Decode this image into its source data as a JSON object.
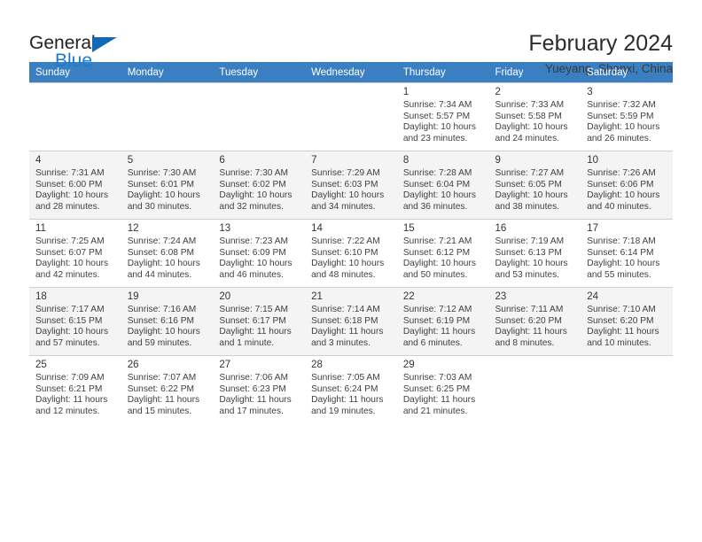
{
  "logo": {
    "word_top": "General",
    "word_bottom": "Blue",
    "accent_color": "#1268b3",
    "blue_text_color": "#1a7bd4"
  },
  "header": {
    "title": "February 2024",
    "subtitle": "Yueyang, Shanxi, China",
    "header_bg": "#3a7fc1"
  },
  "weekdays": [
    "Sunday",
    "Monday",
    "Tuesday",
    "Wednesday",
    "Thursday",
    "Friday",
    "Saturday"
  ],
  "weeks": [
    [
      {
        "day": "",
        "info": ""
      },
      {
        "day": "",
        "info": ""
      },
      {
        "day": "",
        "info": ""
      },
      {
        "day": "",
        "info": ""
      },
      {
        "day": "1",
        "info": "Sunrise: 7:34 AM\nSunset: 5:57 PM\nDaylight: 10 hours\nand 23 minutes."
      },
      {
        "day": "2",
        "info": "Sunrise: 7:33 AM\nSunset: 5:58 PM\nDaylight: 10 hours\nand 24 minutes."
      },
      {
        "day": "3",
        "info": "Sunrise: 7:32 AM\nSunset: 5:59 PM\nDaylight: 10 hours\nand 26 minutes."
      }
    ],
    [
      {
        "day": "4",
        "info": "Sunrise: 7:31 AM\nSunset: 6:00 PM\nDaylight: 10 hours\nand 28 minutes."
      },
      {
        "day": "5",
        "info": "Sunrise: 7:30 AM\nSunset: 6:01 PM\nDaylight: 10 hours\nand 30 minutes."
      },
      {
        "day": "6",
        "info": "Sunrise: 7:30 AM\nSunset: 6:02 PM\nDaylight: 10 hours\nand 32 minutes."
      },
      {
        "day": "7",
        "info": "Sunrise: 7:29 AM\nSunset: 6:03 PM\nDaylight: 10 hours\nand 34 minutes."
      },
      {
        "day": "8",
        "info": "Sunrise: 7:28 AM\nSunset: 6:04 PM\nDaylight: 10 hours\nand 36 minutes."
      },
      {
        "day": "9",
        "info": "Sunrise: 7:27 AM\nSunset: 6:05 PM\nDaylight: 10 hours\nand 38 minutes."
      },
      {
        "day": "10",
        "info": "Sunrise: 7:26 AM\nSunset: 6:06 PM\nDaylight: 10 hours\nand 40 minutes."
      }
    ],
    [
      {
        "day": "11",
        "info": "Sunrise: 7:25 AM\nSunset: 6:07 PM\nDaylight: 10 hours\nand 42 minutes."
      },
      {
        "day": "12",
        "info": "Sunrise: 7:24 AM\nSunset: 6:08 PM\nDaylight: 10 hours\nand 44 minutes."
      },
      {
        "day": "13",
        "info": "Sunrise: 7:23 AM\nSunset: 6:09 PM\nDaylight: 10 hours\nand 46 minutes."
      },
      {
        "day": "14",
        "info": "Sunrise: 7:22 AM\nSunset: 6:10 PM\nDaylight: 10 hours\nand 48 minutes."
      },
      {
        "day": "15",
        "info": "Sunrise: 7:21 AM\nSunset: 6:12 PM\nDaylight: 10 hours\nand 50 minutes."
      },
      {
        "day": "16",
        "info": "Sunrise: 7:19 AM\nSunset: 6:13 PM\nDaylight: 10 hours\nand 53 minutes."
      },
      {
        "day": "17",
        "info": "Sunrise: 7:18 AM\nSunset: 6:14 PM\nDaylight: 10 hours\nand 55 minutes."
      }
    ],
    [
      {
        "day": "18",
        "info": "Sunrise: 7:17 AM\nSunset: 6:15 PM\nDaylight: 10 hours\nand 57 minutes."
      },
      {
        "day": "19",
        "info": "Sunrise: 7:16 AM\nSunset: 6:16 PM\nDaylight: 10 hours\nand 59 minutes."
      },
      {
        "day": "20",
        "info": "Sunrise: 7:15 AM\nSunset: 6:17 PM\nDaylight: 11 hours\nand 1 minute."
      },
      {
        "day": "21",
        "info": "Sunrise: 7:14 AM\nSunset: 6:18 PM\nDaylight: 11 hours\nand 3 minutes."
      },
      {
        "day": "22",
        "info": "Sunrise: 7:12 AM\nSunset: 6:19 PM\nDaylight: 11 hours\nand 6 minutes."
      },
      {
        "day": "23",
        "info": "Sunrise: 7:11 AM\nSunset: 6:20 PM\nDaylight: 11 hours\nand 8 minutes."
      },
      {
        "day": "24",
        "info": "Sunrise: 7:10 AM\nSunset: 6:20 PM\nDaylight: 11 hours\nand 10 minutes."
      }
    ],
    [
      {
        "day": "25",
        "info": "Sunrise: 7:09 AM\nSunset: 6:21 PM\nDaylight: 11 hours\nand 12 minutes."
      },
      {
        "day": "26",
        "info": "Sunrise: 7:07 AM\nSunset: 6:22 PM\nDaylight: 11 hours\nand 15 minutes."
      },
      {
        "day": "27",
        "info": "Sunrise: 7:06 AM\nSunset: 6:23 PM\nDaylight: 11 hours\nand 17 minutes."
      },
      {
        "day": "28",
        "info": "Sunrise: 7:05 AM\nSunset: 6:24 PM\nDaylight: 11 hours\nand 19 minutes."
      },
      {
        "day": "29",
        "info": "Sunrise: 7:03 AM\nSunset: 6:25 PM\nDaylight: 11 hours\nand 21 minutes."
      },
      {
        "day": "",
        "info": ""
      },
      {
        "day": "",
        "info": ""
      }
    ]
  ]
}
